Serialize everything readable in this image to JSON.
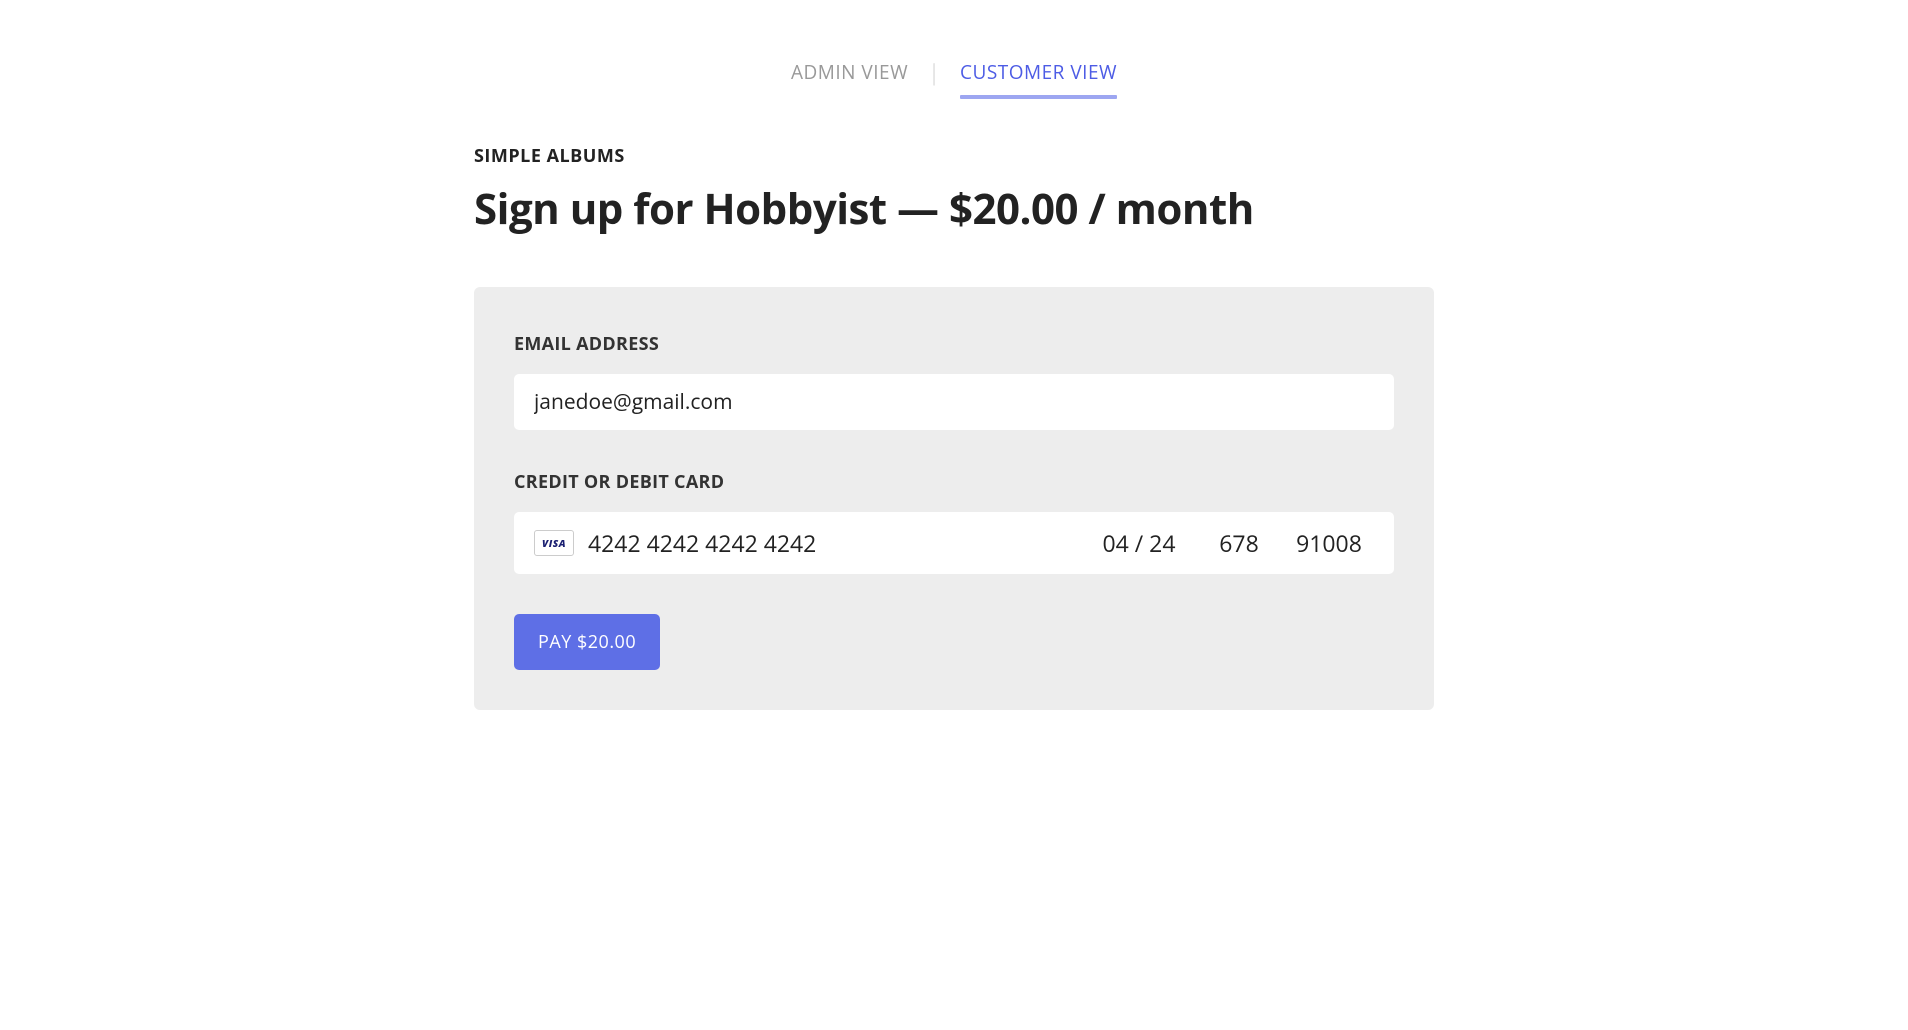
{
  "tabs": {
    "admin": "ADMIN VIEW",
    "customer": "CUSTOMER VIEW"
  },
  "brand": "SIMPLE ALBUMS",
  "heading": "Sign up for Hobbyist — $20.00 / month",
  "form": {
    "email_label": "EMAIL ADDRESS",
    "email_value": "janedoe@gmail.com",
    "card_label": "CREDIT OR DEBIT CARD",
    "card_brand": "VISA",
    "card_number": "4242 4242 4242 4242",
    "card_expiry": "04 / 24",
    "card_cvc": "678",
    "card_zip": "91008",
    "pay_button": "PAY $20.00"
  }
}
